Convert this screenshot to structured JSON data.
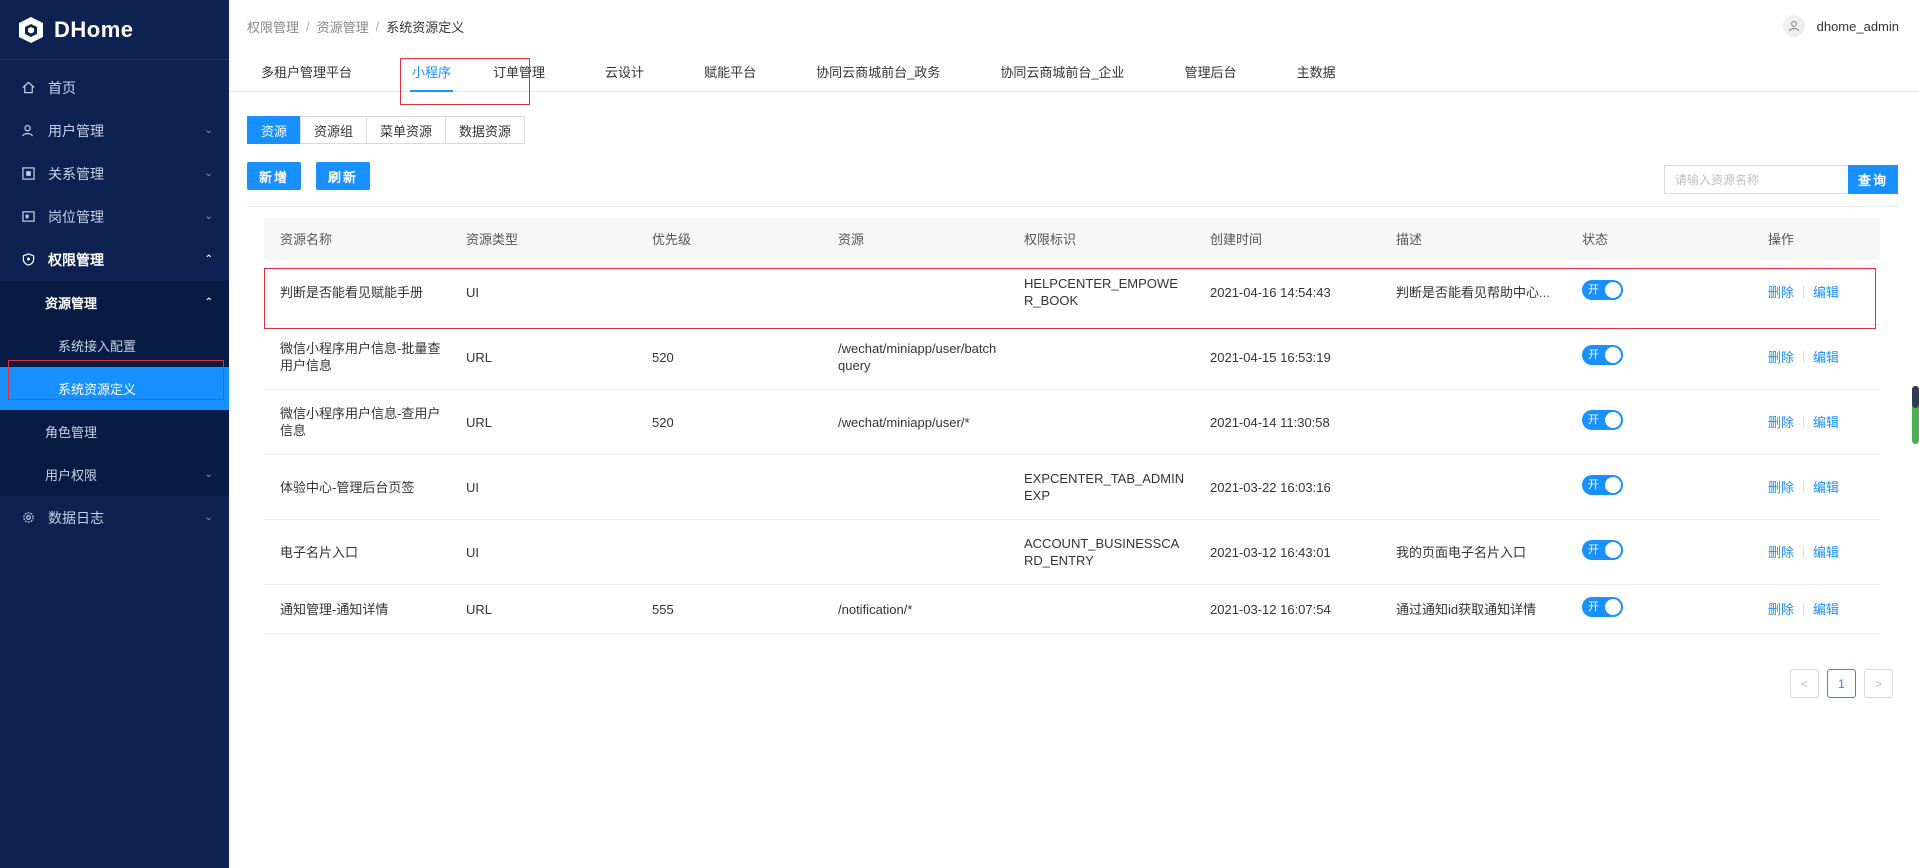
{
  "app": {
    "name": "DHome"
  },
  "sidebar": {
    "items": [
      {
        "label": "首页",
        "icon": "home-icon"
      },
      {
        "label": "用户管理",
        "icon": "user-icon"
      },
      {
        "label": "关系管理",
        "icon": "relation-icon"
      },
      {
        "label": "岗位管理",
        "icon": "position-icon"
      },
      {
        "label": "权限管理",
        "icon": "shield-icon"
      },
      {
        "label": "数据日志",
        "icon": "gear-icon"
      }
    ],
    "submenu": {
      "resource": "资源管理",
      "resource_children": [
        "系统接入配置",
        "系统资源定义"
      ],
      "role": "角色管理",
      "user_perm": "用户权限"
    }
  },
  "header": {
    "breadcrumb": [
      "权限管理",
      "资源管理",
      "系统资源定义"
    ],
    "separator": "/",
    "username": "dhome_admin"
  },
  "tabs": [
    "多租户管理平台",
    "小程序",
    "订单管理",
    "云设计",
    "赋能平台",
    "协同云商城前台_政务",
    "协同云商城前台_企业",
    "管理后台",
    "主数据"
  ],
  "segments": [
    "资源",
    "资源组",
    "菜单资源",
    "数据资源"
  ],
  "actions": {
    "add": "新增",
    "refresh": "刷新"
  },
  "search": {
    "placeholder": "请输入资源名称",
    "button": "查询"
  },
  "table": {
    "columns": [
      "资源名称",
      "资源类型",
      "优先级",
      "资源",
      "权限标识",
      "创建时间",
      "描述",
      "状态",
      "操作"
    ],
    "rows": [
      {
        "name": "判断是否能看见赋能手册",
        "type": "UI",
        "priority": "",
        "resource": "",
        "perm": "HELPCENTER_EMPOWER_BOOK",
        "created": "2021-04-16 14:54:43",
        "desc": "判断是否能看见帮助中心...",
        "status": "开"
      },
      {
        "name": "微信小程序用户信息-批量查用户信息",
        "type": "URL",
        "priority": "520",
        "resource": "/wechat/miniapp/user/batchquery",
        "perm": "",
        "created": "2021-04-15 16:53:19",
        "desc": "",
        "status": "开"
      },
      {
        "name": "微信小程序用户信息-查用户信息",
        "type": "URL",
        "priority": "520",
        "resource": "/wechat/miniapp/user/*",
        "perm": "",
        "created": "2021-04-14 11:30:58",
        "desc": "",
        "status": "开"
      },
      {
        "name": "体验中心-管理后台页签",
        "type": "UI",
        "priority": "",
        "resource": "",
        "perm": "EXPCENTER_TAB_ADMINEXP",
        "created": "2021-03-22 16:03:16",
        "desc": "",
        "status": "开"
      },
      {
        "name": "电子名片入口",
        "type": "UI",
        "priority": "",
        "resource": "",
        "perm": "ACCOUNT_BUSINESSCARD_ENTRY",
        "created": "2021-03-12 16:43:01",
        "desc": "我的页面电子名片入口",
        "status": "开"
      },
      {
        "name": "通知管理-通知详情",
        "type": "URL",
        "priority": "555",
        "resource": "/notification/*",
        "perm": "",
        "created": "2021-03-12 16:07:54",
        "desc": "通过通知id获取通知详情",
        "status": "开"
      }
    ],
    "op_delete": "删除",
    "op_edit": "编辑"
  },
  "pagination": {
    "prev": "<",
    "current": "1",
    "next": ">"
  },
  "colors": {
    "sidebar_bg": "#0d2251",
    "accent": "#1890ff",
    "highlight_box": "#e0303a"
  }
}
